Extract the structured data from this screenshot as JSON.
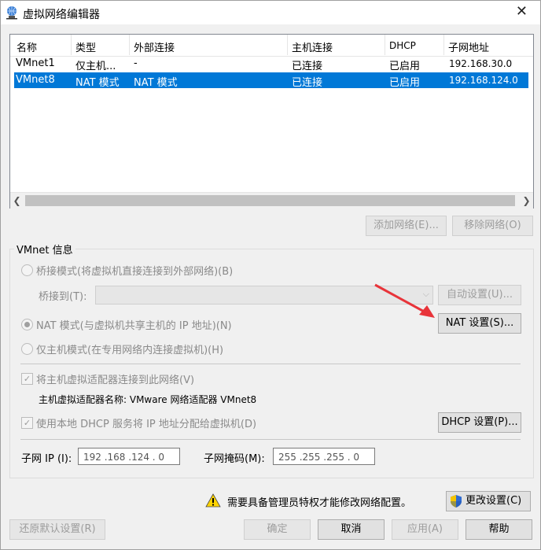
{
  "window": {
    "title": "虚拟网络编辑器",
    "close": "✕"
  },
  "table": {
    "columns": [
      "名称",
      "类型",
      "外部连接",
      "主机连接",
      "DHCP",
      "子网地址"
    ],
    "rows": [
      {
        "name": "VMnet1",
        "type": "仅主机...",
        "external": "-",
        "host": "已连接",
        "dhcp": "已启用",
        "subnet": "192.168.30.0",
        "selected": false
      },
      {
        "name": "VMnet8",
        "type": "NAT 模式",
        "external": "NAT 模式",
        "host": "已连接",
        "dhcp": "已启用",
        "subnet": "192.168.124.0",
        "selected": true
      }
    ]
  },
  "buttons": {
    "add_network": "添加网络(E)...",
    "remove_network": "移除网络(O)",
    "auto_settings": "自动设置(U)...",
    "nat_settings": "NAT 设置(S)...",
    "dhcp_settings": "DHCP 设置(P)...",
    "change_settings": "更改设置(C)",
    "restore_defaults": "还原默认设置(R)",
    "ok": "确定",
    "cancel": "取消",
    "apply": "应用(A)",
    "help": "帮助"
  },
  "vmnet_info": {
    "group_label": "VMnet 信息",
    "bridge_mode": "桥接模式(将虚拟机直接连接到外部网络)(B)",
    "bridge_to_label": "桥接到(T):",
    "bridge_to_value": "",
    "nat_mode": "NAT 模式(与虚拟机共享主机的 IP 地址)(N)",
    "host_only_mode": "仅主机模式(在专用网络内连接虚拟机)(H)",
    "connect_adapter": "将主机虚拟适配器连接到此网络(V)",
    "adapter_name": "主机虚拟适配器名称: VMware 网络适配器 VMnet8",
    "use_dhcp": "使用本地 DHCP 服务将 IP 地址分配给虚拟机(D)",
    "subnet_ip_label": "子网 IP (I):",
    "subnet_ip_value": "192 .168 .124 .  0",
    "subnet_mask_label": "子网掩码(M):",
    "subnet_mask_value": "255 .255 .255 .  0"
  },
  "admin_notice": "需要具备管理员特权才能修改网络配置。",
  "colors": {
    "selection": "#0078d7",
    "arrow": "#e8343a"
  }
}
